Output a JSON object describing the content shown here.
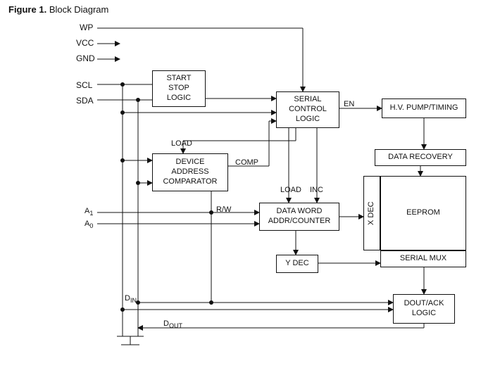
{
  "figure": {
    "label": "Figure 1.",
    "title": "Block Diagram"
  },
  "pins": {
    "wp": "WP",
    "vcc": "VCC",
    "gnd": "GND",
    "scl": "SCL",
    "sda": "SDA",
    "a1_html": "A<span class=\"sub\">1</span>",
    "a0_html": "A<span class=\"sub\">0</span>",
    "din_html": "D<span class=\"sub\">IN</span>",
    "dout_html": "D<span class=\"sub\">OUT</span>"
  },
  "blocks": {
    "start_stop": "START\nSTOP\nLOGIC",
    "serial_ctrl": "SERIAL\nCONTROL\nLOGIC",
    "hv_pump": "H.V. PUMP/TIMING",
    "dev_addr": "DEVICE\nADDRESS\nCOMPARATOR",
    "data_word": "DATA WORD\nADDR/COUNTER",
    "data_recov": "DATA RECOVERY",
    "eeprom": "EEPROM",
    "ydec": "Y DEC",
    "xdec_vert": "X DEC",
    "serial_mux": "SERIAL MUX",
    "dout_ack_html": "D<span class=\"sub\">OUT</span>/ACK\nLOGIC"
  },
  "wires": {
    "en": "EN",
    "load": "LOAD",
    "comp": "COMP",
    "load2": "LOAD",
    "inc": "INC",
    "rw": "R/W"
  }
}
